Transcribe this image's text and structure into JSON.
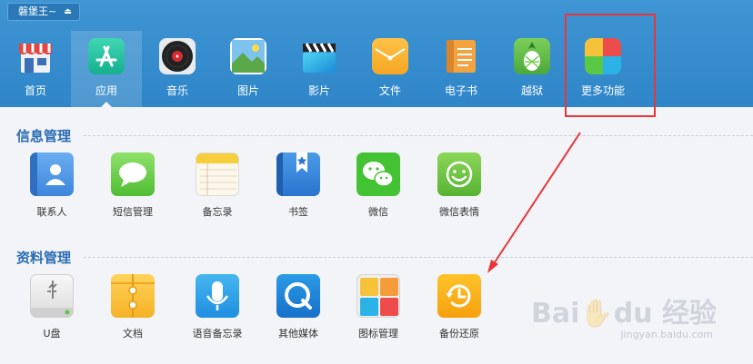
{
  "device": {
    "name": "磐堡王~"
  },
  "nav": [
    {
      "key": "home",
      "label": "首页",
      "icon": "store-icon"
    },
    {
      "key": "apps",
      "label": "应用",
      "icon": "app-store-icon"
    },
    {
      "key": "music",
      "label": "音乐",
      "icon": "vinyl-record-icon"
    },
    {
      "key": "photos",
      "label": "图片",
      "icon": "picture-icon"
    },
    {
      "key": "video",
      "label": "影片",
      "icon": "clapperboard-icon"
    },
    {
      "key": "files",
      "label": "文件",
      "icon": "folder-icon"
    },
    {
      "key": "ebooks",
      "label": "电子书",
      "icon": "book-icon"
    },
    {
      "key": "jailbreak",
      "label": "越狱",
      "icon": "pineapple-icon"
    },
    {
      "key": "more",
      "label": "更多功能",
      "icon": "tiles-icon"
    }
  ],
  "active_nav": "apps",
  "sections": [
    {
      "title": "信息管理",
      "items": [
        {
          "label": "联系人",
          "icon": "contacts-icon"
        },
        {
          "label": "短信管理",
          "icon": "message-bubble-icon"
        },
        {
          "label": "备忘录",
          "icon": "notes-icon"
        },
        {
          "label": "书签",
          "icon": "bookmark-star-icon"
        },
        {
          "label": "微信",
          "icon": "wechat-icon"
        },
        {
          "label": "微信表情",
          "icon": "smiley-icon"
        }
      ]
    },
    {
      "title": "资料管理",
      "items": [
        {
          "label": "U盘",
          "icon": "usb-drive-icon"
        },
        {
          "label": "文档",
          "icon": "document-folder-icon"
        },
        {
          "label": "语音备忘录",
          "icon": "microphone-icon"
        },
        {
          "label": "其他媒体",
          "icon": "quicktime-icon"
        },
        {
          "label": "图标管理",
          "icon": "icon-grid-icon"
        },
        {
          "label": "备份还原",
          "icon": "backup-restore-icon"
        }
      ]
    }
  ],
  "annotation_color": "#e8363b",
  "watermark": {
    "brand": "Baidu经验",
    "url": "jingyan.baidu.com"
  }
}
